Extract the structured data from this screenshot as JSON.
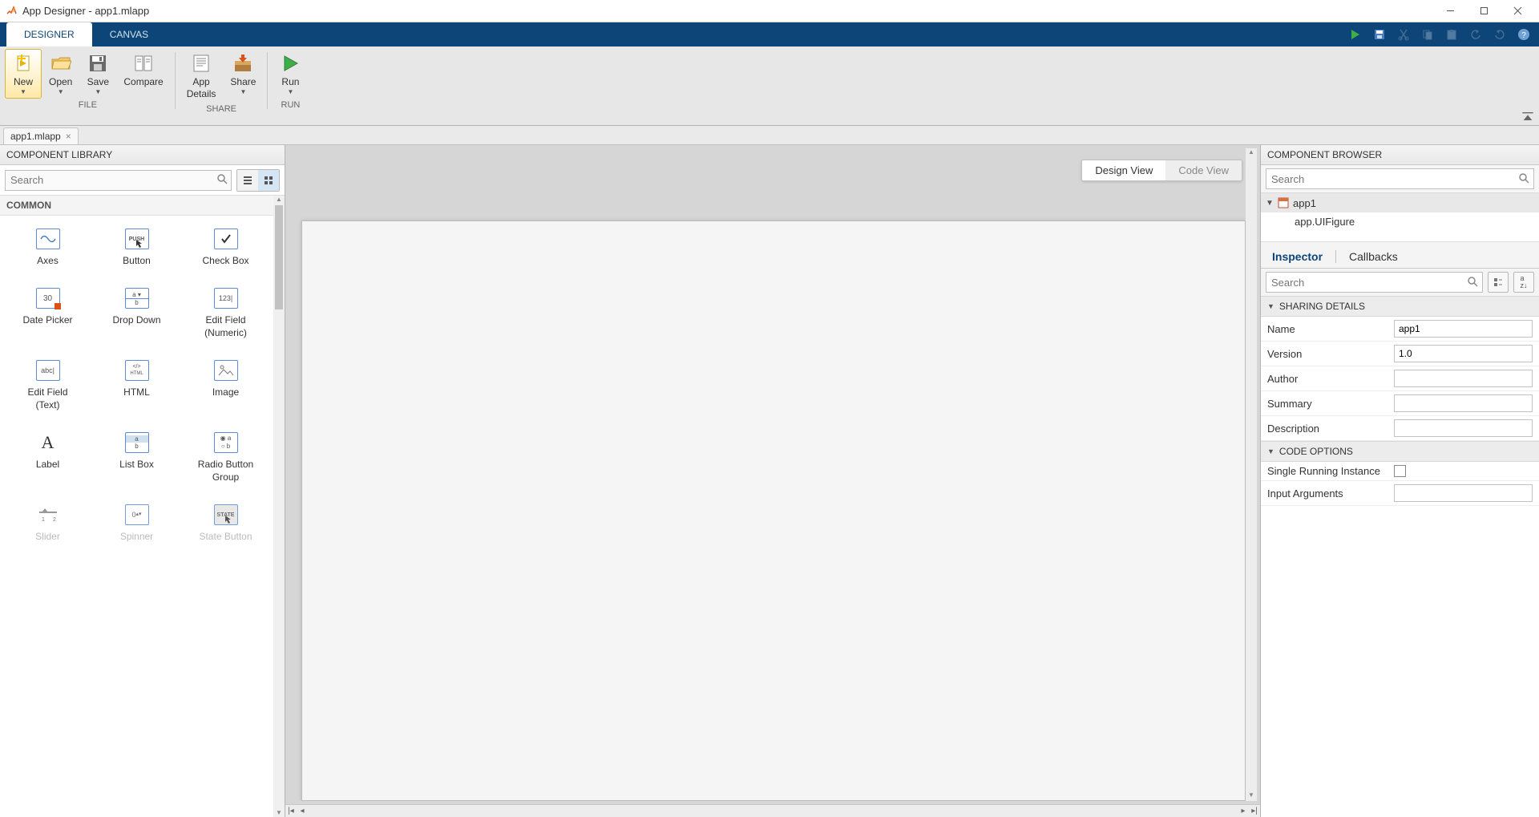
{
  "window": {
    "title": "App Designer - app1.mlapp"
  },
  "tabstrip": {
    "designer": "DESIGNER",
    "canvas": "CANVAS"
  },
  "toolstrip": {
    "new": "New",
    "open": "Open",
    "save": "Save",
    "compare": "Compare",
    "app_details_l1": "App",
    "app_details_l2": "Details",
    "share": "Share",
    "run": "Run",
    "group_file": "FILE",
    "group_share": "SHARE",
    "group_run": "RUN"
  },
  "doctab": {
    "name": "app1.mlapp"
  },
  "library": {
    "title": "COMPONENT LIBRARY",
    "search_placeholder": "Search",
    "category_common": "COMMON",
    "items": {
      "axes": "Axes",
      "button": "Button",
      "checkbox": "Check Box",
      "datepicker": "Date Picker",
      "dropdown": "Drop Down",
      "editnum_l1": "Edit Field",
      "editnum_l2": "(Numeric)",
      "edittxt_l1": "Edit Field",
      "edittxt_l2": "(Text)",
      "html": "HTML",
      "image": "Image",
      "label": "Label",
      "listbox": "List Box",
      "rbg_l1": "Radio Button",
      "rbg_l2": "Group",
      "slider": "Slider",
      "spinner": "Spinner",
      "statebutton": "State Button"
    }
  },
  "canvas": {
    "design_view": "Design View",
    "code_view": "Code View"
  },
  "browser": {
    "title": "COMPONENT BROWSER",
    "search_placeholder": "Search",
    "root": "app1",
    "child1": "app.UIFigure"
  },
  "inspector": {
    "tab_inspector": "Inspector",
    "tab_callbacks": "Callbacks",
    "search_placeholder": "Search",
    "cat_sharing": "SHARING DETAILS",
    "cat_code": "CODE OPTIONS",
    "p_name": "Name",
    "p_name_val": "app1",
    "p_version": "Version",
    "p_version_val": "1.0",
    "p_author": "Author",
    "p_author_val": "",
    "p_summary": "Summary",
    "p_summary_val": "",
    "p_description": "Description",
    "p_description_val": "",
    "p_single": "Single Running Instance",
    "p_inputargs": "Input Arguments",
    "p_inputargs_val": ""
  }
}
